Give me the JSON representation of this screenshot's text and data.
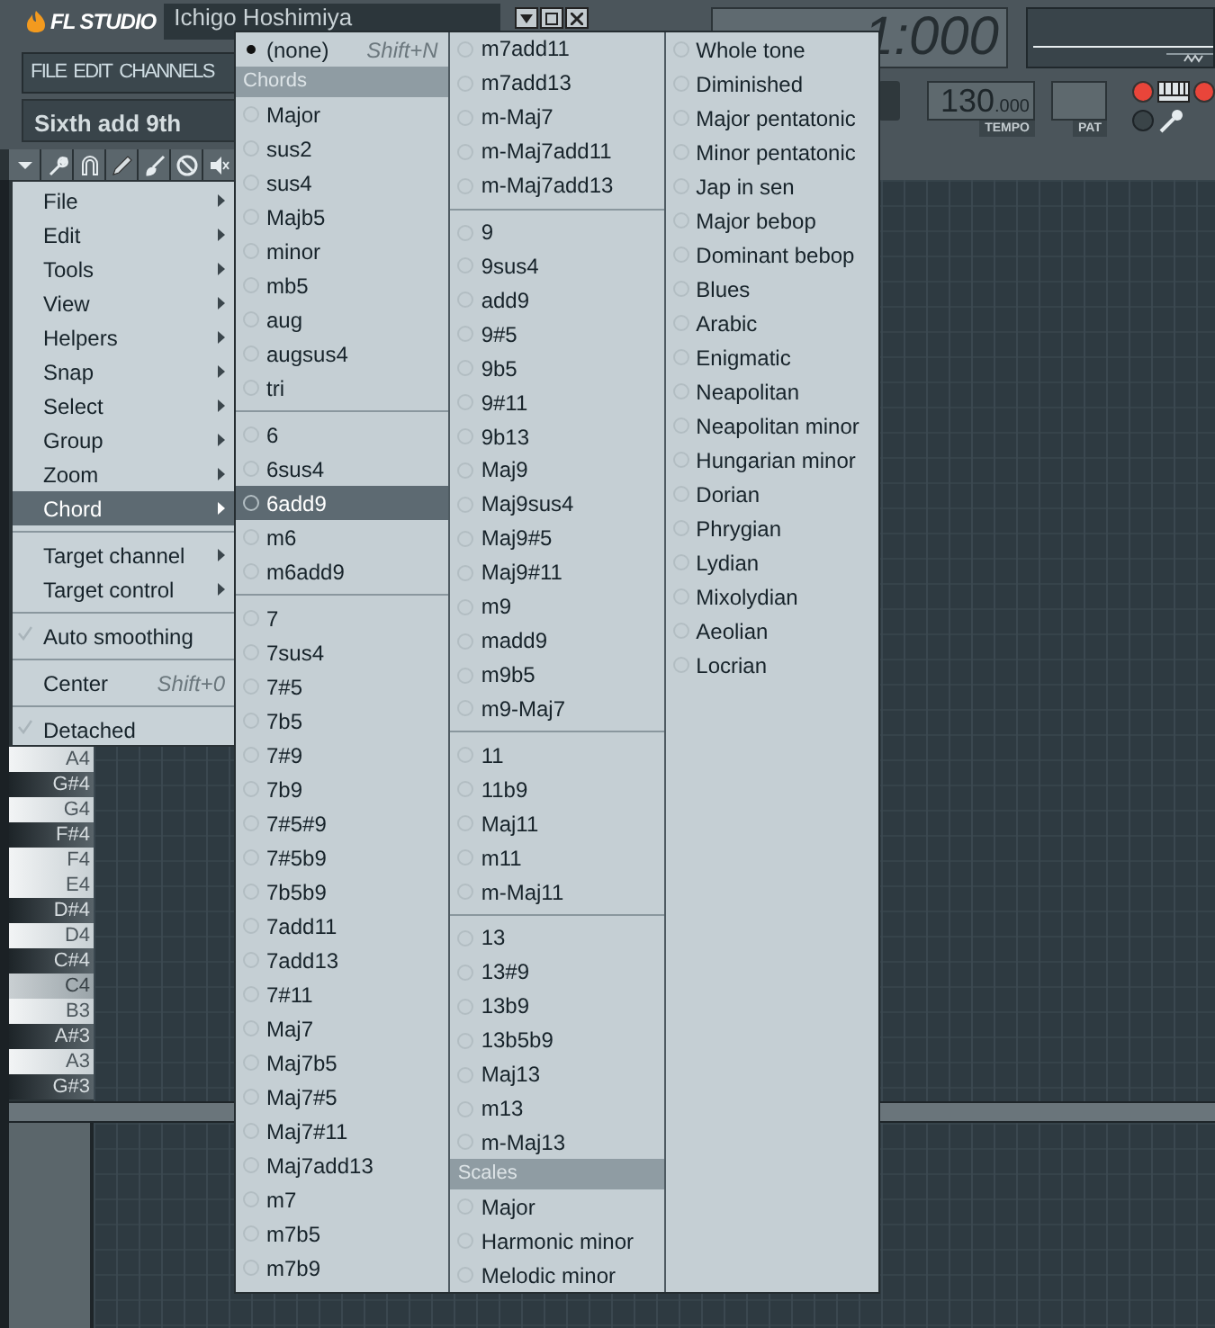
{
  "app": {
    "logo": "FL STUDIO",
    "title": "Ichigo Hoshimiya",
    "main_menu": [
      "FILE",
      "EDIT",
      "CHANNELS"
    ],
    "hint": "Sixth add 9th",
    "song_position": "1:000",
    "tempo": {
      "value": "130$_{.000}$",
      "label": "TEMPO"
    },
    "pattern": {
      "label": "PAT"
    }
  },
  "context_menu": {
    "items": [
      {
        "kind": "submenu",
        "label": "File",
        "selected": false
      },
      {
        "kind": "submenu",
        "label": "Edit",
        "selected": false
      },
      {
        "kind": "submenu",
        "label": "Tools",
        "selected": false
      },
      {
        "kind": "submenu",
        "label": "View",
        "selected": false
      },
      {
        "kind": "submenu",
        "label": "Helpers",
        "selected": false
      },
      {
        "kind": "submenu",
        "label": "Snap",
        "selected": false
      },
      {
        "kind": "submenu",
        "label": "Select",
        "selected": false
      },
      {
        "kind": "submenu",
        "label": "Group",
        "selected": false
      },
      {
        "kind": "submenu",
        "label": "Zoom",
        "selected": false
      },
      {
        "kind": "submenu",
        "label": "Chord",
        "selected": true
      },
      {
        "kind": "separator"
      },
      {
        "kind": "submenu",
        "label": "Target channel",
        "selected": false
      },
      {
        "kind": "submenu",
        "label": "Target control",
        "selected": false
      },
      {
        "kind": "separator"
      },
      {
        "kind": "check",
        "label": "Auto smoothing",
        "checked": true,
        "selected": false
      },
      {
        "kind": "separator"
      },
      {
        "kind": "action",
        "label": "Center",
        "shortcut": "Shift+0",
        "selected": false
      },
      {
        "kind": "separator"
      },
      {
        "kind": "check",
        "label": "Detached",
        "checked": true,
        "selected": false
      }
    ]
  },
  "chord_menu": {
    "columns": [
      {
        "items": [
          {
            "kind": "radio",
            "label": "(none)",
            "shortcut": "Shift+N",
            "checked": true,
            "selected": false
          },
          {
            "kind": "header",
            "label": "Chords"
          },
          {
            "kind": "radio",
            "label": "Major",
            "checked": false,
            "selected": false
          },
          {
            "kind": "radio",
            "label": "sus2",
            "checked": false,
            "selected": false
          },
          {
            "kind": "radio",
            "label": "sus4",
            "checked": false,
            "selected": false
          },
          {
            "kind": "radio",
            "label": "Majb5",
            "checked": false,
            "selected": false
          },
          {
            "kind": "radio",
            "label": "minor",
            "checked": false,
            "selected": false
          },
          {
            "kind": "radio",
            "label": "mb5",
            "checked": false,
            "selected": false
          },
          {
            "kind": "radio",
            "label": "aug",
            "checked": false,
            "selected": false
          },
          {
            "kind": "radio",
            "label": "augsus4",
            "checked": false,
            "selected": false
          },
          {
            "kind": "radio",
            "label": "tri",
            "checked": false,
            "selected": false
          },
          {
            "kind": "separator"
          },
          {
            "kind": "radio",
            "label": "6",
            "checked": false,
            "selected": false
          },
          {
            "kind": "radio",
            "label": "6sus4",
            "checked": false,
            "selected": false
          },
          {
            "kind": "radio",
            "label": "6add9",
            "checked": false,
            "selected": true
          },
          {
            "kind": "radio",
            "label": "m6",
            "checked": false,
            "selected": false
          },
          {
            "kind": "radio",
            "label": "m6add9",
            "checked": false,
            "selected": false
          },
          {
            "kind": "separator"
          },
          {
            "kind": "radio",
            "label": "7",
            "checked": false,
            "selected": false
          },
          {
            "kind": "radio",
            "label": "7sus4",
            "checked": false,
            "selected": false
          },
          {
            "kind": "radio",
            "label": "7#5",
            "checked": false,
            "selected": false
          },
          {
            "kind": "radio",
            "label": "7b5",
            "checked": false,
            "selected": false
          },
          {
            "kind": "radio",
            "label": "7#9",
            "checked": false,
            "selected": false
          },
          {
            "kind": "radio",
            "label": "7b9",
            "checked": false,
            "selected": false
          },
          {
            "kind": "radio",
            "label": "7#5#9",
            "checked": false,
            "selected": false
          },
          {
            "kind": "radio",
            "label": "7#5b9",
            "checked": false,
            "selected": false
          },
          {
            "kind": "radio",
            "label": "7b5b9",
            "checked": false,
            "selected": false
          },
          {
            "kind": "radio",
            "label": "7add11",
            "checked": false,
            "selected": false
          },
          {
            "kind": "radio",
            "label": "7add13",
            "checked": false,
            "selected": false
          },
          {
            "kind": "radio",
            "label": "7#11",
            "checked": false,
            "selected": false
          },
          {
            "kind": "radio",
            "label": "Maj7",
            "checked": false,
            "selected": false
          },
          {
            "kind": "radio",
            "label": "Maj7b5",
            "checked": false,
            "selected": false
          },
          {
            "kind": "radio",
            "label": "Maj7#5",
            "checked": false,
            "selected": false
          },
          {
            "kind": "radio",
            "label": "Maj7#11",
            "checked": false,
            "selected": false
          },
          {
            "kind": "radio",
            "label": "Maj7add13",
            "checked": false,
            "selected": false
          },
          {
            "kind": "radio",
            "label": "m7",
            "checked": false,
            "selected": false
          },
          {
            "kind": "radio",
            "label": "m7b5",
            "checked": false,
            "selected": false
          },
          {
            "kind": "radio",
            "label": "m7b9",
            "checked": false,
            "selected": false
          }
        ]
      },
      {
        "items": [
          {
            "kind": "radio",
            "label": "m7add11",
            "checked": false,
            "selected": false
          },
          {
            "kind": "radio",
            "label": "m7add13",
            "checked": false,
            "selected": false
          },
          {
            "kind": "radio",
            "label": "m-Maj7",
            "checked": false,
            "selected": false
          },
          {
            "kind": "radio",
            "label": "m-Maj7add11",
            "checked": false,
            "selected": false
          },
          {
            "kind": "radio",
            "label": "m-Maj7add13",
            "checked": false,
            "selected": false
          },
          {
            "kind": "separator"
          },
          {
            "kind": "radio",
            "label": "9",
            "checked": false,
            "selected": false
          },
          {
            "kind": "radio",
            "label": "9sus4",
            "checked": false,
            "selected": false
          },
          {
            "kind": "radio",
            "label": "add9",
            "checked": false,
            "selected": false
          },
          {
            "kind": "radio",
            "label": "9#5",
            "checked": false,
            "selected": false
          },
          {
            "kind": "radio",
            "label": "9b5",
            "checked": false,
            "selected": false
          },
          {
            "kind": "radio",
            "label": "9#11",
            "checked": false,
            "selected": false
          },
          {
            "kind": "radio",
            "label": "9b13",
            "checked": false,
            "selected": false
          },
          {
            "kind": "radio",
            "label": "Maj9",
            "checked": false,
            "selected": false
          },
          {
            "kind": "radio",
            "label": "Maj9sus4",
            "checked": false,
            "selected": false
          },
          {
            "kind": "radio",
            "label": "Maj9#5",
            "checked": false,
            "selected": false
          },
          {
            "kind": "radio",
            "label": "Maj9#11",
            "checked": false,
            "selected": false
          },
          {
            "kind": "radio",
            "label": "m9",
            "checked": false,
            "selected": false
          },
          {
            "kind": "radio",
            "label": "madd9",
            "checked": false,
            "selected": false
          },
          {
            "kind": "radio",
            "label": "m9b5",
            "checked": false,
            "selected": false
          },
          {
            "kind": "radio",
            "label": "m9-Maj7",
            "checked": false,
            "selected": false
          },
          {
            "kind": "separator"
          },
          {
            "kind": "radio",
            "label": "11",
            "checked": false,
            "selected": false
          },
          {
            "kind": "radio",
            "label": "11b9",
            "checked": false,
            "selected": false
          },
          {
            "kind": "radio",
            "label": "Maj11",
            "checked": false,
            "selected": false
          },
          {
            "kind": "radio",
            "label": "m11",
            "checked": false,
            "selected": false
          },
          {
            "kind": "radio",
            "label": "m-Maj11",
            "checked": false,
            "selected": false
          },
          {
            "kind": "separator"
          },
          {
            "kind": "radio",
            "label": "13",
            "checked": false,
            "selected": false
          },
          {
            "kind": "radio",
            "label": "13#9",
            "checked": false,
            "selected": false
          },
          {
            "kind": "radio",
            "label": "13b9",
            "checked": false,
            "selected": false
          },
          {
            "kind": "radio",
            "label": "13b5b9",
            "checked": false,
            "selected": false
          },
          {
            "kind": "radio",
            "label": "Maj13",
            "checked": false,
            "selected": false
          },
          {
            "kind": "radio",
            "label": "m13",
            "checked": false,
            "selected": false
          },
          {
            "kind": "radio",
            "label": "m-Maj13",
            "checked": false,
            "selected": false
          },
          {
            "kind": "header",
            "label": "Scales"
          },
          {
            "kind": "radio",
            "label": "Major",
            "checked": false,
            "selected": false
          },
          {
            "kind": "radio",
            "label": "Harmonic minor",
            "checked": false,
            "selected": false
          },
          {
            "kind": "radio",
            "label": "Melodic minor",
            "checked": false,
            "selected": false
          }
        ]
      },
      {
        "items": [
          {
            "kind": "radio",
            "label": "Whole tone",
            "checked": false,
            "selected": false
          },
          {
            "kind": "radio",
            "label": "Diminished",
            "checked": false,
            "selected": false
          },
          {
            "kind": "radio",
            "label": "Major pentatonic",
            "checked": false,
            "selected": false
          },
          {
            "kind": "radio",
            "label": "Minor pentatonic",
            "checked": false,
            "selected": false
          },
          {
            "kind": "radio",
            "label": "Jap in sen",
            "checked": false,
            "selected": false
          },
          {
            "kind": "radio",
            "label": "Major bebop",
            "checked": false,
            "selected": false
          },
          {
            "kind": "radio",
            "label": "Dominant bebop",
            "checked": false,
            "selected": false
          },
          {
            "kind": "radio",
            "label": "Blues",
            "checked": false,
            "selected": false
          },
          {
            "kind": "radio",
            "label": "Arabic",
            "checked": false,
            "selected": false
          },
          {
            "kind": "radio",
            "label": "Enigmatic",
            "checked": false,
            "selected": false
          },
          {
            "kind": "radio",
            "label": "Neapolitan",
            "checked": false,
            "selected": false
          },
          {
            "kind": "radio",
            "label": "Neapolitan minor",
            "checked": false,
            "selected": false
          },
          {
            "kind": "radio",
            "label": "Hungarian minor",
            "checked": false,
            "selected": false
          },
          {
            "kind": "radio",
            "label": "Dorian",
            "checked": false,
            "selected": false
          },
          {
            "kind": "radio",
            "label": "Phrygian",
            "checked": false,
            "selected": false
          },
          {
            "kind": "radio",
            "label": "Lydian",
            "checked": false,
            "selected": false
          },
          {
            "kind": "radio",
            "label": "Mixolydian",
            "checked": false,
            "selected": false
          },
          {
            "kind": "radio",
            "label": "Aeolian",
            "checked": false,
            "selected": false
          },
          {
            "kind": "radio",
            "label": "Locrian",
            "checked": false,
            "selected": false
          }
        ]
      }
    ]
  },
  "piano_keys": [
    {
      "label": "A4",
      "kind": "white"
    },
    {
      "label": "G#4",
      "kind": "black"
    },
    {
      "label": "G4",
      "kind": "white"
    },
    {
      "label": "F#4",
      "kind": "black"
    },
    {
      "label": "F4",
      "kind": "white"
    },
    {
      "label": "E4",
      "kind": "white"
    },
    {
      "label": "D#4",
      "kind": "black"
    },
    {
      "label": "D4",
      "kind": "white"
    },
    {
      "label": "C#4",
      "kind": "black"
    },
    {
      "label": "C4",
      "kind": "marked"
    },
    {
      "label": "B3",
      "kind": "white"
    },
    {
      "label": "A#3",
      "kind": "black"
    },
    {
      "label": "A3",
      "kind": "white"
    },
    {
      "label": "G#3",
      "kind": "black"
    }
  ]
}
